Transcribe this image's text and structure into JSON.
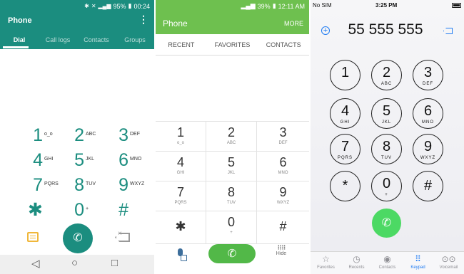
{
  "panels": {
    "lg": {
      "status": {
        "icons": [
          "bluetooth-icon",
          "mute-icon",
          "nfc-icon",
          "signal-icon"
        ],
        "battery": "95%",
        "time": "00:24"
      },
      "title": "Phone",
      "tabs": [
        "Dial",
        "Call logs",
        "Contacts",
        "Groups"
      ],
      "active_tab": "Dial",
      "keys": [
        {
          "digit": "1",
          "letters": "ᴏ_ᴏ"
        },
        {
          "digit": "2",
          "letters": "ABC"
        },
        {
          "digit": "3",
          "letters": "DEF"
        },
        {
          "digit": "4",
          "letters": "GHI"
        },
        {
          "digit": "5",
          "letters": "JKL"
        },
        {
          "digit": "6",
          "letters": "MNO"
        },
        {
          "digit": "7",
          "letters": "PQRS"
        },
        {
          "digit": "8",
          "letters": "TUV"
        },
        {
          "digit": "9",
          "letters": "WXYZ"
        },
        {
          "digit": "✱",
          "letters": ""
        },
        {
          "digit": "0",
          "letters": "+"
        },
        {
          "digit": "#",
          "letters": ""
        }
      ],
      "accent": "#1b8d7f"
    },
    "samsung": {
      "status": {
        "battery": "39%",
        "time": "12:11 AM"
      },
      "title": "Phone",
      "more": "MORE",
      "tabs": [
        "RECENT",
        "FAVORITES",
        "CONTACTS"
      ],
      "keys": [
        {
          "digit": "1",
          "letters": "ᴏ_ᴏ"
        },
        {
          "digit": "2",
          "letters": "ABC"
        },
        {
          "digit": "3",
          "letters": "DEF"
        },
        {
          "digit": "4",
          "letters": "GHI"
        },
        {
          "digit": "5",
          "letters": "JKL"
        },
        {
          "digit": "6",
          "letters": "MNO"
        },
        {
          "digit": "7",
          "letters": "PQRS"
        },
        {
          "digit": "8",
          "letters": "TUV"
        },
        {
          "digit": "9",
          "letters": "WXYZ"
        },
        {
          "digit": "✱",
          "letters": ""
        },
        {
          "digit": "0",
          "letters": "+"
        },
        {
          "digit": "#",
          "letters": ""
        }
      ],
      "hide_label": "Hide",
      "accent": "#6ec04f"
    },
    "ios": {
      "status": {
        "carrier": "No SIM",
        "time": "3:25 PM"
      },
      "number": "55 555 555",
      "keys": [
        {
          "digit": "1",
          "letters": ""
        },
        {
          "digit": "2",
          "letters": "ABC"
        },
        {
          "digit": "3",
          "letters": "DEF"
        },
        {
          "digit": "4",
          "letters": "GHI"
        },
        {
          "digit": "5",
          "letters": "JKL"
        },
        {
          "digit": "6",
          "letters": "MNO"
        },
        {
          "digit": "7",
          "letters": "PQRS"
        },
        {
          "digit": "8",
          "letters": "TUV"
        },
        {
          "digit": "9",
          "letters": "WXYZ"
        },
        {
          "digit": "*",
          "letters": ""
        },
        {
          "digit": "0",
          "letters": "+"
        },
        {
          "digit": "#",
          "letters": ""
        }
      ],
      "tabbar": [
        {
          "label": "Favorites",
          "icon": "star-icon"
        },
        {
          "label": "Recents",
          "icon": "clock-icon"
        },
        {
          "label": "Contacts",
          "icon": "person-icon"
        },
        {
          "label": "Keypad",
          "icon": "keypad-icon"
        },
        {
          "label": "Voicemail",
          "icon": "voicemail-icon"
        }
      ],
      "active_tab": "Keypad",
      "accent": "#1f7bf2",
      "call_color": "#4cd964"
    }
  }
}
